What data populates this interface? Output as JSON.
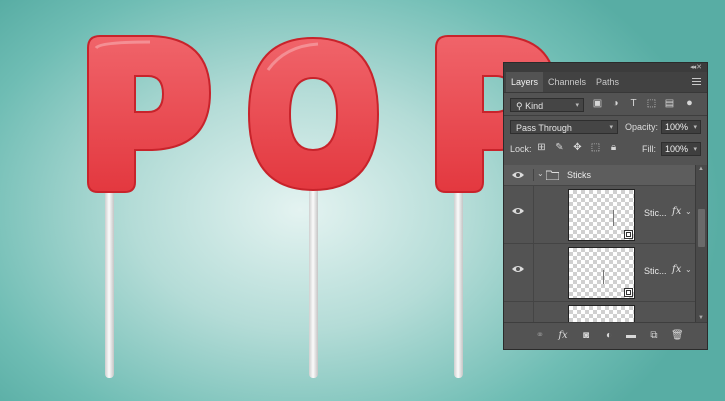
{
  "canvas": {
    "letters": [
      "P",
      "O",
      "P"
    ]
  },
  "panel": {
    "tabs": [
      {
        "label": "Layers",
        "active": true
      },
      {
        "label": "Channels",
        "active": false
      },
      {
        "label": "Paths",
        "active": false
      }
    ],
    "filter": {
      "kind_label": "Kind"
    },
    "blend_mode": "Pass Through",
    "opacity": {
      "label": "Opacity:",
      "value": "100%"
    },
    "lock": {
      "label": "Lock:"
    },
    "fill": {
      "label": "Fill:",
      "value": "100%"
    },
    "group": {
      "name": "Sticks"
    },
    "layers": [
      {
        "name": "Stic...",
        "fx": "fx"
      },
      {
        "name": "Stic...",
        "fx": "fx"
      }
    ],
    "bottom_fx": "fx"
  },
  "colors": {
    "accent": "#e0343c",
    "panel_bg": "#535353",
    "canvas_bg": "#7cc3ba"
  }
}
